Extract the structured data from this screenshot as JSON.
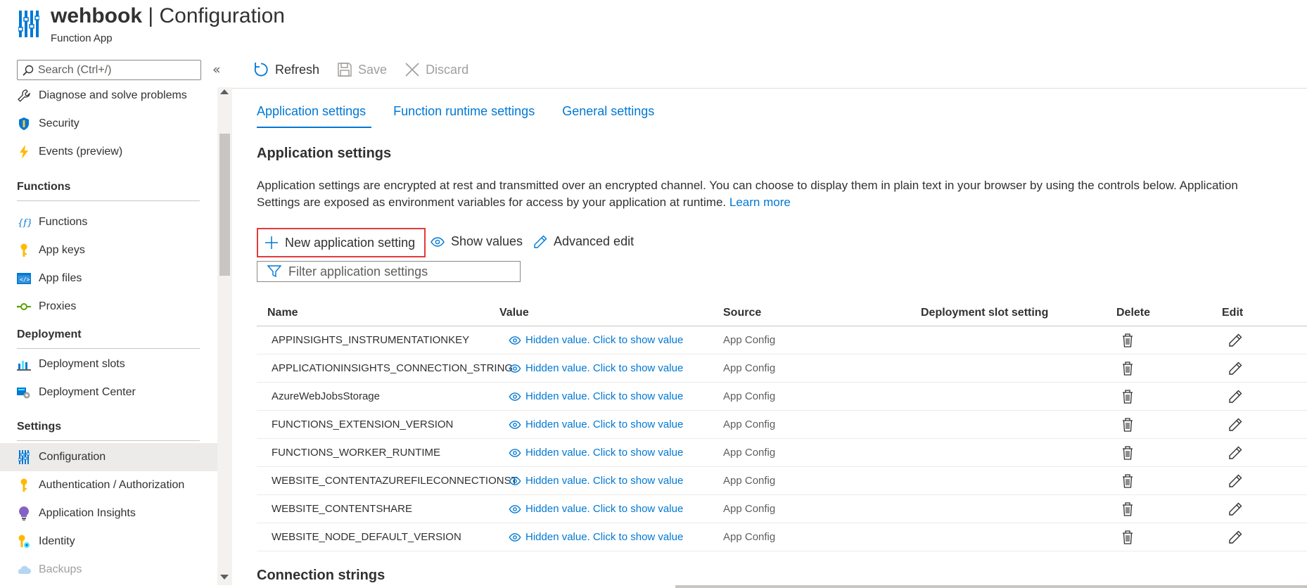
{
  "header": {
    "app_name": "wehbook",
    "separator": "|",
    "page": "Configuration",
    "subtitle": "Function App",
    "brand_color": "#0078d4"
  },
  "nav": {
    "search_placeholder": "Search (Ctrl+/)",
    "collapse_icon": "«",
    "items_top": [
      {
        "label": "Diagnose and solve problems",
        "icon": "wrench-icon"
      },
      {
        "label": "Security",
        "icon": "shield-icon"
      },
      {
        "label": "Events (preview)",
        "icon": "lightning-icon"
      }
    ],
    "sections": [
      {
        "title": "Functions",
        "items": [
          {
            "label": "Functions",
            "icon": "function-icon"
          },
          {
            "label": "App keys",
            "icon": "key-icon"
          },
          {
            "label": "App files",
            "icon": "code-file-icon"
          },
          {
            "label": "Proxies",
            "icon": "proxy-icon"
          }
        ]
      },
      {
        "title": "Deployment",
        "items": [
          {
            "label": "Deployment slots",
            "icon": "slots-icon"
          },
          {
            "label": "Deployment Center",
            "icon": "deployment-center-icon"
          }
        ]
      },
      {
        "title": "Settings",
        "items": [
          {
            "label": "Configuration",
            "icon": "configuration-icon",
            "active": true
          },
          {
            "label": "Authentication / Authorization",
            "icon": "key-icon"
          },
          {
            "label": "Application Insights",
            "icon": "lightbulb-icon"
          },
          {
            "label": "Identity",
            "icon": "identity-icon"
          },
          {
            "label": "Backups",
            "icon": "cloud-icon",
            "disabled": true
          }
        ]
      }
    ]
  },
  "toolbar": {
    "refresh": "Refresh",
    "save": "Save",
    "discard": "Discard"
  },
  "tabs": [
    {
      "label": "Application settings",
      "active": true
    },
    {
      "label": "Function runtime settings"
    },
    {
      "label": "General settings"
    }
  ],
  "main": {
    "section_title": "Application settings",
    "description": "Application settings are encrypted at rest and transmitted over an encrypted channel. You can choose to display them in plain text in your browser by using the controls below. Application Settings are exposed as environment variables for access by your application at runtime.",
    "learn_more": "Learn more",
    "new_setting": "New application setting",
    "show_values": "Show values",
    "advanced_edit": "Advanced edit",
    "filter_placeholder": "Filter application settings",
    "connection_strings_title": "Connection strings"
  },
  "table": {
    "columns": [
      "Name",
      "Value",
      "Source",
      "Deployment slot setting",
      "Delete",
      "Edit"
    ],
    "rows": [
      {
        "name": "APPINSIGHTS_INSTRUMENTATIONKEY",
        "value": "Hidden value. Click to show value",
        "source": "App Config"
      },
      {
        "name": "APPLICATIONINSIGHTS_CONNECTION_STRING",
        "value": "Hidden value. Click to show value",
        "source": "App Config"
      },
      {
        "name": "AzureWebJobsStorage",
        "value": "Hidden value. Click to show value",
        "source": "App Config"
      },
      {
        "name": "FUNCTIONS_EXTENSION_VERSION",
        "value": "Hidden value. Click to show value",
        "source": "App Config"
      },
      {
        "name": "FUNCTIONS_WORKER_RUNTIME",
        "value": "Hidden value. Click to show value",
        "source": "App Config"
      },
      {
        "name": "WEBSITE_CONTENTAZUREFILECONNECTIONST",
        "value": "Hidden value. Click to show value",
        "source": "App Config"
      },
      {
        "name": "WEBSITE_CONTENTSHARE",
        "value": "Hidden value. Click to show value",
        "source": "App Config"
      },
      {
        "name": "WEBSITE_NODE_DEFAULT_VERSION",
        "value": "Hidden value. Click to show value",
        "source": "App Config"
      }
    ]
  },
  "colors": {
    "link": "#0078d4",
    "highlight_border": "#e23b3b",
    "active_nav_bg": "#edebe9"
  }
}
